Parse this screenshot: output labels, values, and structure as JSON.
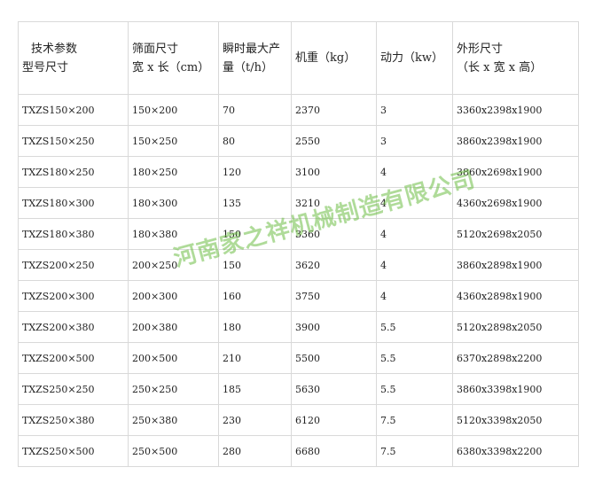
{
  "table": {
    "header": {
      "col1_line1": "技术参数",
      "col1_line2": "型号尺寸",
      "col2_line1": "筛面尺寸",
      "col2_line2": "宽 x 长（cm）",
      "col3_line1": "瞬时最大产",
      "col3_line2": "量（t/h）",
      "col4": "机重（kg）",
      "col5": "动力（kw）",
      "col6_line1": "外形尺寸",
      "col6_line2": "（长 x 宽 x 高）"
    },
    "rows": [
      {
        "model": "TXZS150×200",
        "screen": "150×200",
        "capacity": "70",
        "weight": "2370",
        "power": "3",
        "dims": "3360x2398x1900"
      },
      {
        "model": "TXZS150×250",
        "screen": "150×250",
        "capacity": "80",
        "weight": "2550",
        "power": "3",
        "dims": "3860x2398x1900"
      },
      {
        "model": "TXZS180×250",
        "screen": "180×250",
        "capacity": "120",
        "weight": "3100",
        "power": "4",
        "dims": "3860x2698x1900"
      },
      {
        "model": "TXZS180×300",
        "screen": "180×300",
        "capacity": "135",
        "weight": "3210",
        "power": "4",
        "dims": "4360x2698x1900"
      },
      {
        "model": "TXZS180×380",
        "screen": "180×380",
        "capacity": "150",
        "weight": "3360",
        "power": "4",
        "dims": "5120x2698x2050"
      },
      {
        "model": "TXZS200×250",
        "screen": "200×250",
        "capacity": "150",
        "weight": "3620",
        "power": "4",
        "dims": "3860x2898x1900"
      },
      {
        "model": "TXZS200×300",
        "screen": "200×300",
        "capacity": "160",
        "weight": "3750",
        "power": "4",
        "dims": "4360x2898x1900"
      },
      {
        "model": "TXZS200×380",
        "screen": "200×380",
        "capacity": "180",
        "weight": "3900",
        "power": "5.5",
        "dims": "5120x2898x2050"
      },
      {
        "model": "TXZS200×500",
        "screen": "200×500",
        "capacity": "210",
        "weight": "5500",
        "power": "5.5",
        "dims": "6370x2898x2200"
      },
      {
        "model": "TXZS250×250",
        "screen": "250×250",
        "capacity": "185",
        "weight": "5630",
        "power": "5.5",
        "dims": "3860x3398x1900"
      },
      {
        "model": "TXZS250×380",
        "screen": "250×380",
        "capacity": "230",
        "weight": "6120",
        "power": "7.5",
        "dims": "5120x3398x2050"
      },
      {
        "model": "TXZS250×500",
        "screen": "250×500",
        "capacity": "280",
        "weight": "6680",
        "power": "7.5",
        "dims": "6380x3398x2200"
      }
    ]
  },
  "watermark": {
    "text": "河南家之祥机械制造有限公司"
  }
}
